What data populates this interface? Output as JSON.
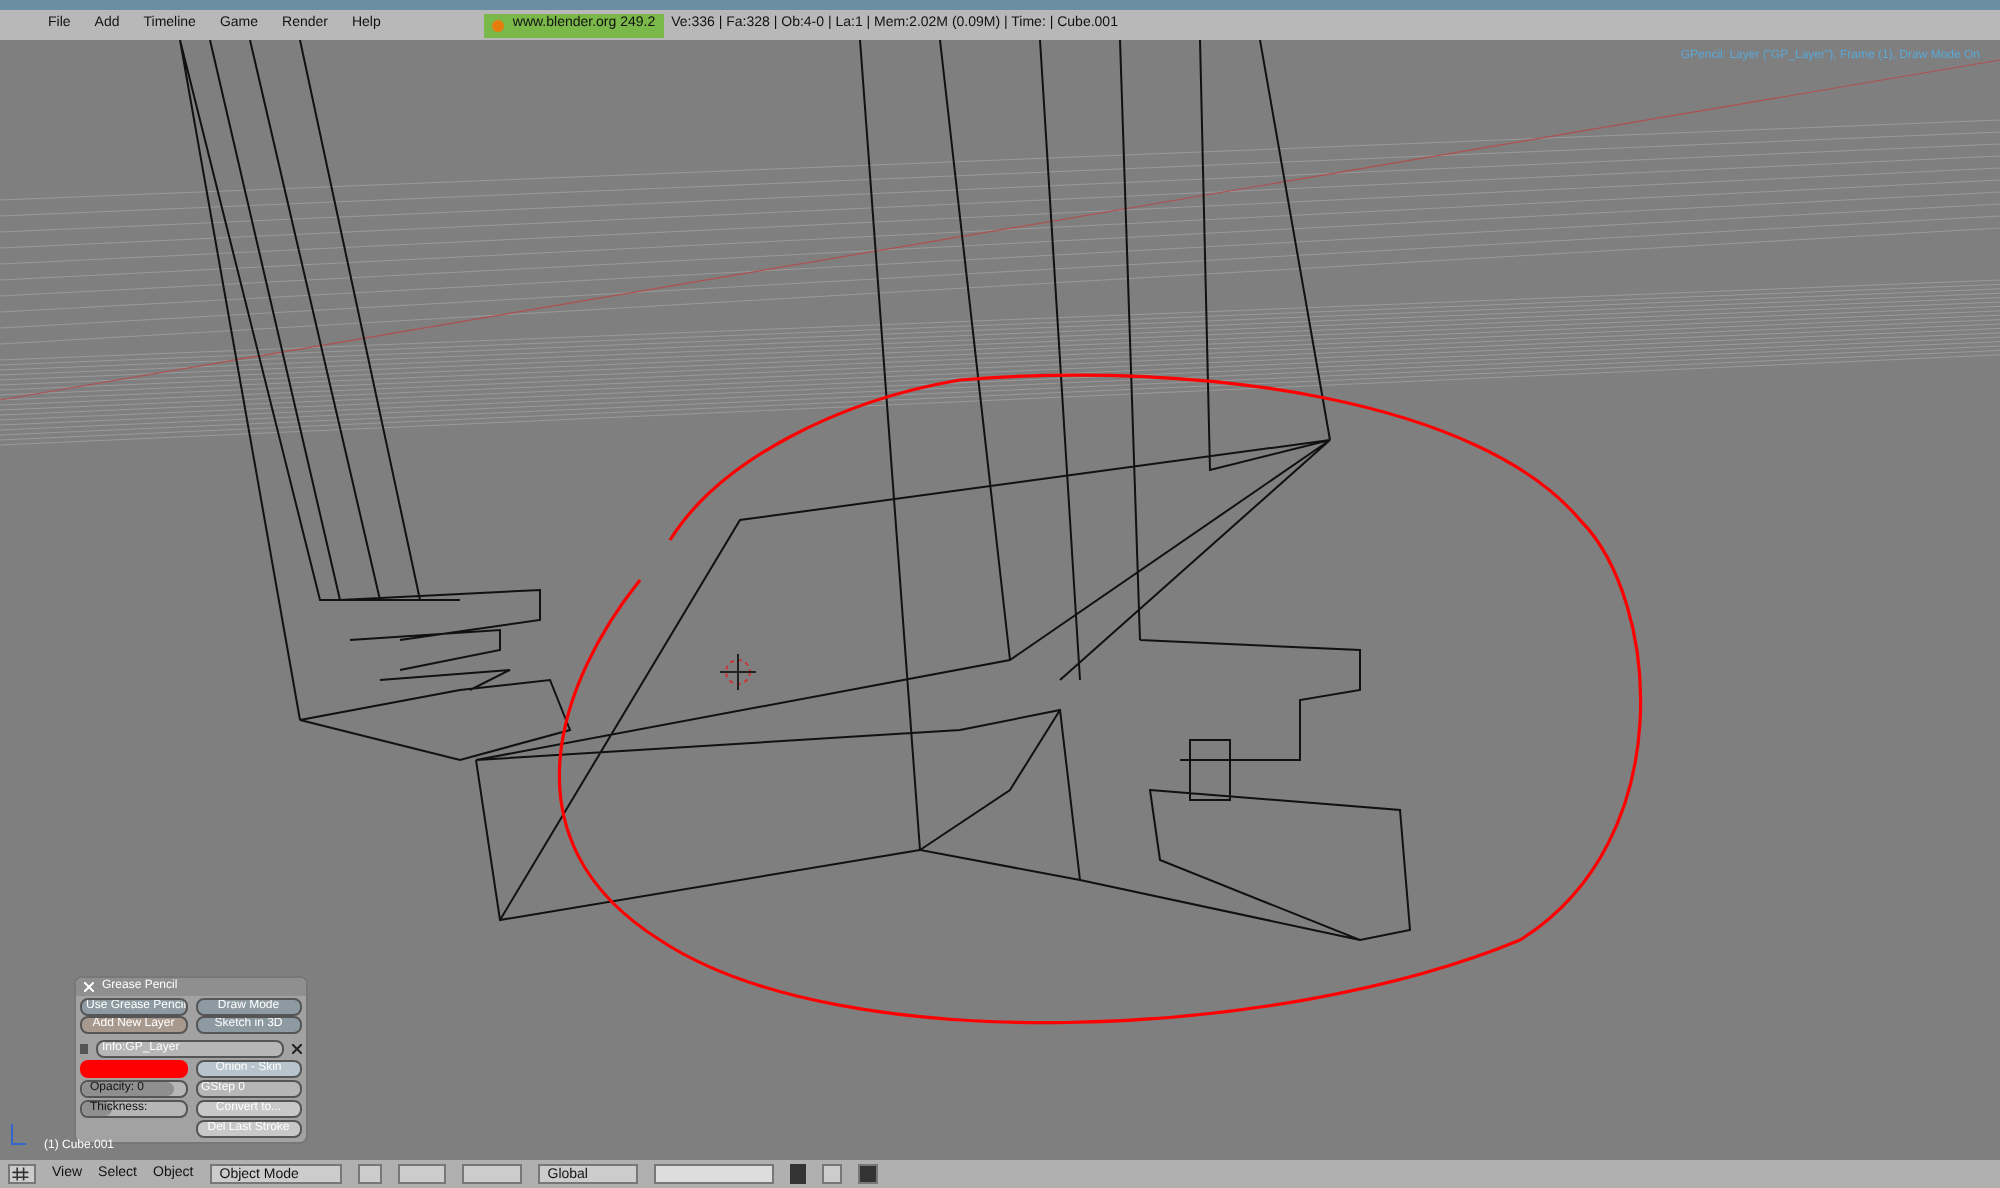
{
  "menu": [
    "File",
    "Add",
    "Timeline",
    "Game",
    "Render",
    "Help"
  ],
  "site": "www.blender.org 249.2",
  "stats": "Ve:336 | Fa:328 | Ob:4-0 | La:1  | Mem:2.02M (0.09M)  | Time: | Cube.001",
  "viewport": {
    "info": "GPencil: Layer (\"GP_Layer\"), Frame (1), Draw Mode On",
    "object_label": "(1) Cube.001"
  },
  "grease_panel": {
    "title": "Grease Pencil",
    "use_button": "Use Grease Pencil",
    "new_layer": "Add New Layer",
    "draw_mode": "Draw Mode",
    "sketch": "Sketch in 3D",
    "layer_name": "Info:GP_Layer",
    "color": "#ff0000",
    "opacity": {
      "text": "Opacity: 0",
      "level": 0.9
    },
    "onion": "Onion - Skin",
    "gstep": "GStep 0",
    "thickness": {
      "text": "Thickness:",
      "level": 0.3
    },
    "convert": "Convert to...",
    "del_stroke": "Del Last Stroke"
  },
  "header": {
    "menu": [
      "View",
      "Select",
      "Object"
    ],
    "mode": "Object Mode",
    "orientation": "Global"
  }
}
